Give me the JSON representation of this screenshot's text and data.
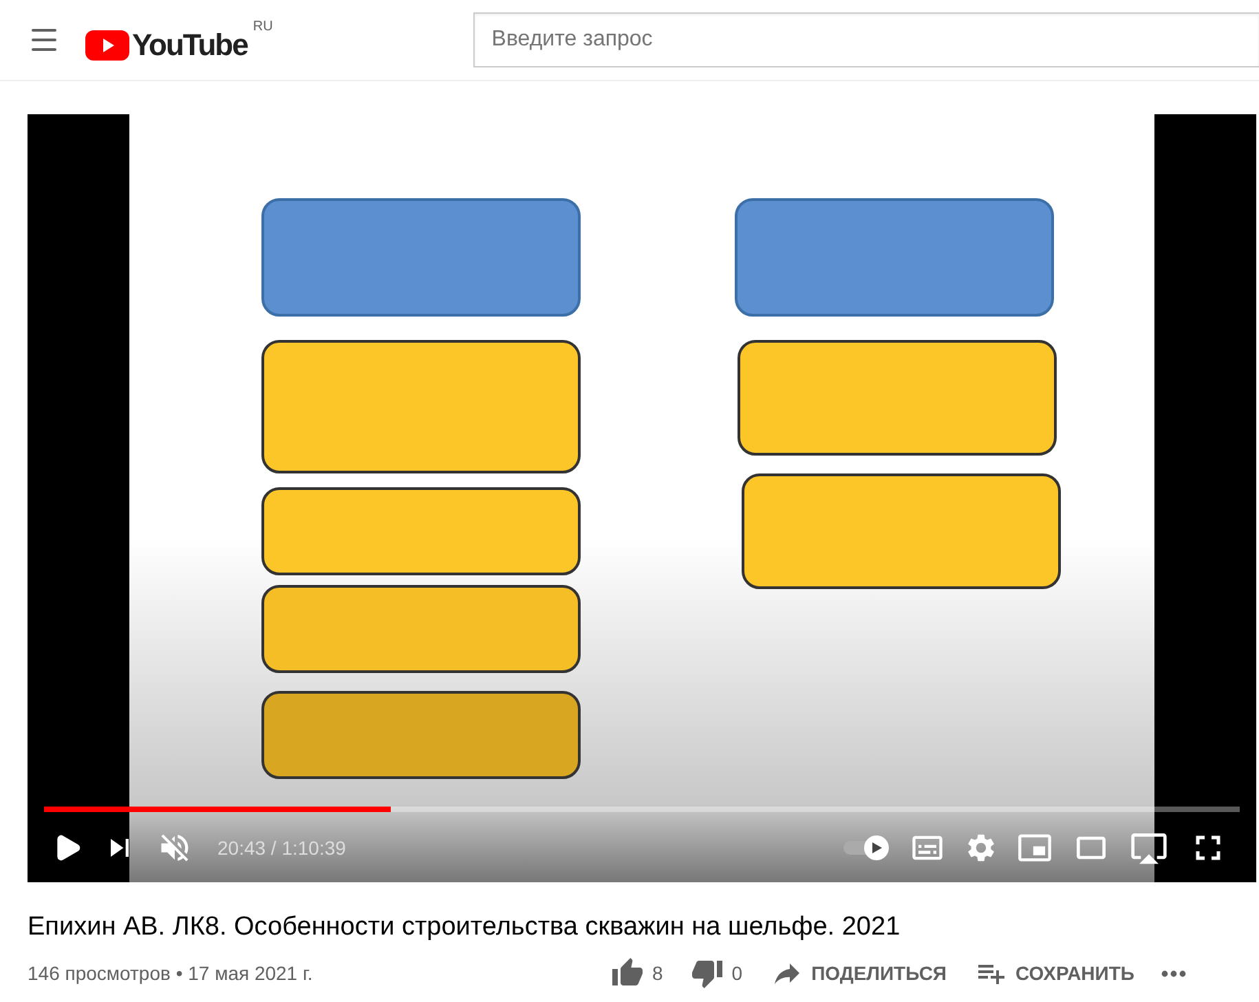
{
  "header": {
    "logo_text": "YouTube",
    "region": "RU",
    "search": {
      "placeholder": "Введите запрос"
    }
  },
  "player": {
    "progress": {
      "level": 0.29
    },
    "autoplay": {
      "on": true
    },
    "muted": true,
    "time": "20:43 / 1:10:39"
  },
  "video_info": {
    "title": "Епихин АВ. ЛК8. Особенности строительства скважин на шельфе. 2021",
    "meta": "146 просмотров • 17 мая 2021 г.",
    "actions": [
      {
        "kind": "like",
        "label": "8"
      },
      {
        "kind": "dislike",
        "label": "0"
      },
      {
        "kind": "share",
        "label": "ПОДЕЛИТЬСЯ"
      },
      {
        "kind": "save",
        "label": "СОХРАНИТЬ"
      },
      {
        "kind": "more"
      }
    ]
  }
}
